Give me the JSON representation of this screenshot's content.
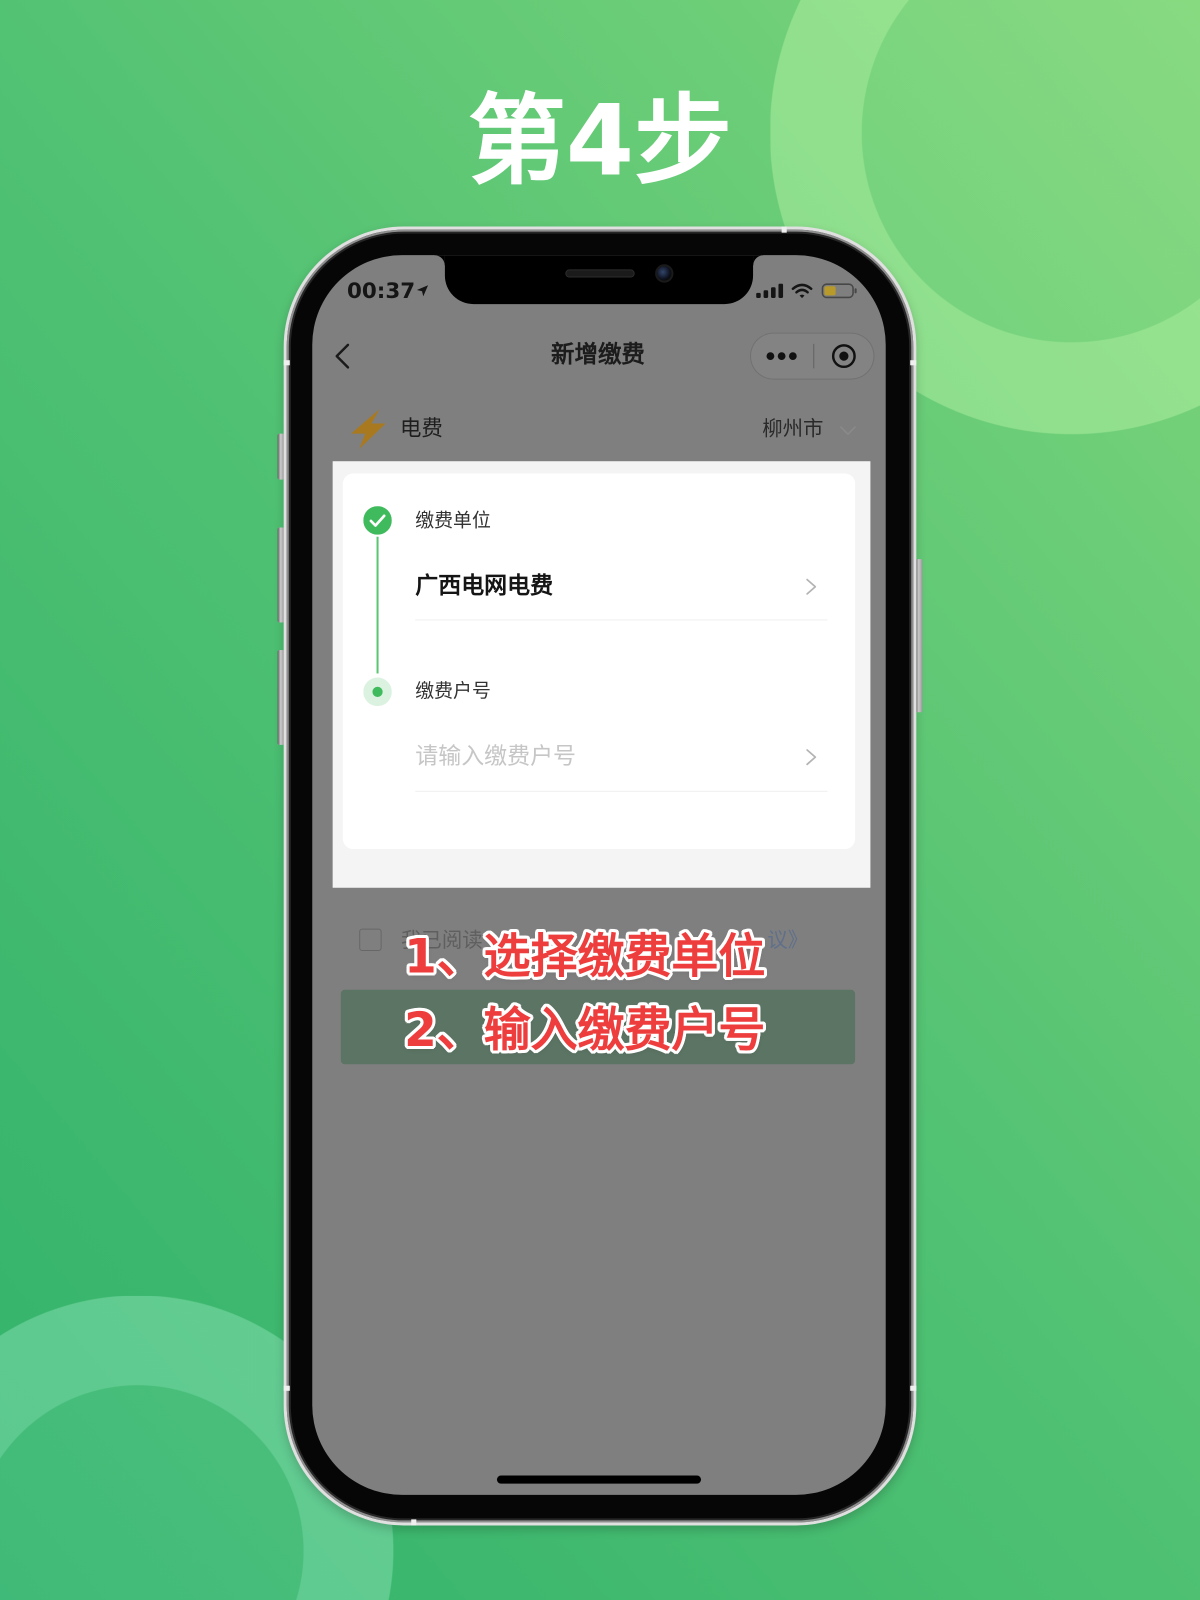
{
  "page": {
    "title": "第4步"
  },
  "status_bar": {
    "time": "00:37",
    "signal_bars": 4,
    "battery_level": 0.42,
    "icons": [
      "location-arrow-icon",
      "signal-icon",
      "wifi-icon",
      "battery-icon"
    ]
  },
  "nav": {
    "title": "新增缴费",
    "icons": [
      "chevron-left-icon",
      "more-icon",
      "target-icon"
    ]
  },
  "category": {
    "name": "电费",
    "city": "柳州市",
    "icons": [
      "lightning-icon",
      "chevron-down-icon"
    ]
  },
  "form": {
    "steps": [
      {
        "label": "缴费单位",
        "value": "广西电网电费",
        "completed": true,
        "icon": "check-circle-icon"
      },
      {
        "label": "缴费户号",
        "placeholder": "请输入缴费户号",
        "completed": false,
        "icon": "dot-circle-icon"
      }
    ]
  },
  "agreement": {
    "checked": false,
    "text_start": "我已阅读",
    "text_end": "议》"
  },
  "annotations": [
    "1、选择缴费单位",
    "2、输入缴费户号"
  ],
  "colors": {
    "bg-left": "#31b26b",
    "bg-mid": "#52c273",
    "bg-right": "#80d67b",
    "accent-green": "#3fbb5d",
    "annotation-red": "#ee3d3d",
    "lightning": "#a9791f",
    "battery-yellow": "#b89a2a",
    "mask-gray": "#7f7f7f",
    "button-dimmed": "#5c7464"
  }
}
